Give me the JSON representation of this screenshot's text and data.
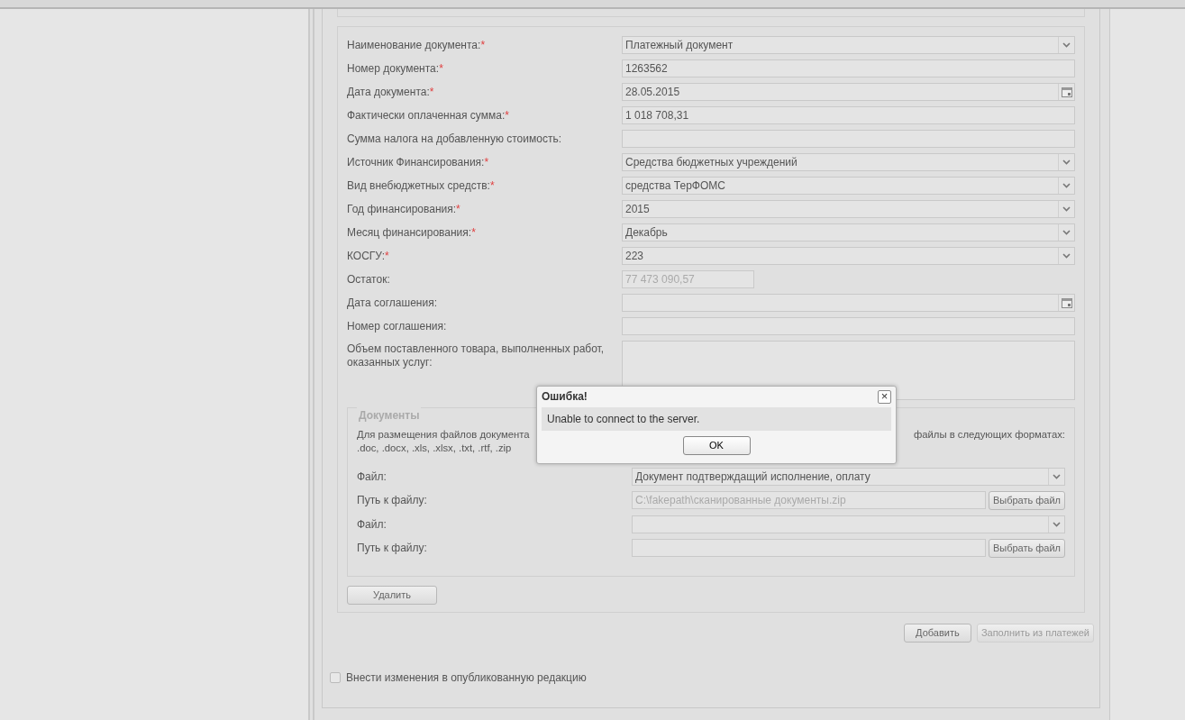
{
  "form": {
    "fields": [
      {
        "label": "Наименование документа:",
        "mark": "*",
        "kind": "select",
        "value": "Платежный документ"
      },
      {
        "label": "Номер документа:",
        "mark": "*",
        "kind": "text",
        "value": "1263562"
      },
      {
        "label": "Дата документа:",
        "mark": "*",
        "kind": "date",
        "value": "28.05.2015"
      },
      {
        "label": "Фактически оплаченная сумма:",
        "mark": "*",
        "kind": "text",
        "value": "1 018 708,31"
      },
      {
        "label": "Сумма налога на добавленную стоимость:",
        "kind": "text"
      },
      {
        "label": "Источник Финансирования:",
        "mark": "*",
        "kind": "select",
        "value": "Средства бюджетных учреждений"
      },
      {
        "label": "Вид внебюджетных средств:",
        "mark": "*",
        "kind": "select",
        "value": "средства ТерФОМС"
      },
      {
        "label": "Год финансирования:",
        "mark": "*",
        "kind": "select",
        "value": "2015"
      },
      {
        "label": "Месяц финансирования:",
        "mark": "*",
        "kind": "select",
        "value": "Декабрь"
      },
      {
        "label": "КОСГУ:",
        "mark": "*",
        "kind": "select",
        "value": "223"
      },
      {
        "label": "Остаток:",
        "kind": "readonly",
        "value": "77 473 090,57"
      },
      {
        "label": "Дата соглашения:",
        "kind": "date"
      },
      {
        "label": "Номер соглашения:",
        "kind": "text"
      },
      {
        "label": "Объем поставленного товара, выполненных работ, оказанных услуг:",
        "kind": "textarea"
      }
    ],
    "documents": {
      "legend": "Документы",
      "hint_left": [
        "Для размещения файлов документа",
        ".doc, .docx, .xls, .xlsx, .txt, .rtf, .zip"
      ],
      "hint_right": "файлы в следующих форматах:",
      "rows": [
        {
          "label": "Файл:",
          "kind": "select",
          "value": "Документ подтверждащий исполнение, оплату"
        },
        {
          "label": "Путь к файлу:",
          "kind": "file",
          "value": "C:\\fakepath\\сканированные документы.zip",
          "button": "Выбрать файл"
        },
        {
          "label": "Файл:",
          "kind": "select"
        },
        {
          "label": "Путь к файлу:",
          "kind": "file",
          "button": "Выбрать файл"
        }
      ]
    },
    "delete_button": {
      "label": "Удалить",
      "disabled": false
    }
  },
  "actions": [
    {
      "label": "Добавить",
      "disabled": false
    },
    {
      "label": "Заполнить из платежей",
      "disabled": true
    }
  ],
  "publish_checkbox": {
    "label": "Внести изменения в опубликованную редакцию",
    "checked": false
  },
  "dialog": {
    "title": "Ошибка!",
    "close": "×",
    "message": "Unable to connect to the server.",
    "button": "OK"
  }
}
